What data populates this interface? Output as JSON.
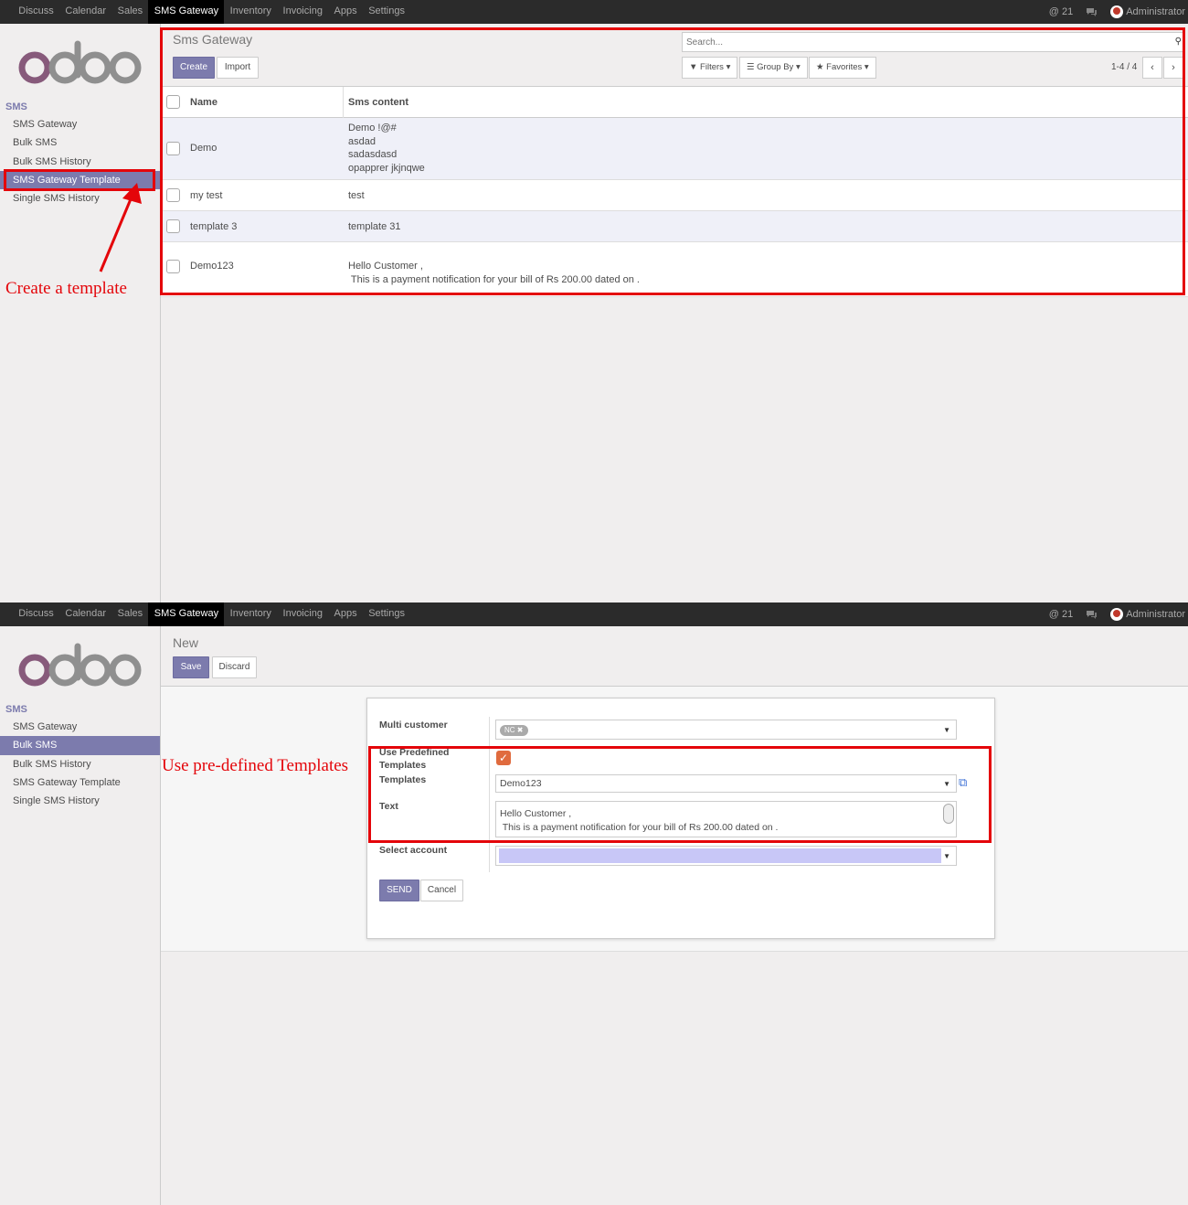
{
  "nav": {
    "menu": [
      "Discuss",
      "Calendar",
      "Sales",
      "SMS Gateway",
      "Inventory",
      "Invoicing",
      "Apps",
      "Settings"
    ],
    "active": "SMS Gateway",
    "notifications": "21",
    "user": "Administrator"
  },
  "sidebar": {
    "section": "SMS",
    "items": [
      "SMS Gateway",
      "Bulk SMS",
      "Bulk SMS History",
      "SMS Gateway Template",
      "Single SMS History"
    ],
    "items2": [
      "SMS Gateway",
      "Bulk SMS",
      "Bulk SMS History",
      "SMS Gateway Template",
      "Single SMS History"
    ]
  },
  "list_view": {
    "title": "Sms Gateway",
    "create_label": "Create",
    "import_label": "Import",
    "search_placeholder": "Search...",
    "filters_label": "Filters",
    "groupby_label": "Group By",
    "favorites_label": "Favorites",
    "pager": "1-4 / 4",
    "columns": [
      "Name",
      "Sms content"
    ],
    "rows": [
      {
        "name": "Demo",
        "content": [
          "Demo !@#",
          "asdad",
          "sadasdasd",
          "opapprer jkjnqwe"
        ]
      },
      {
        "name": "my test",
        "content": [
          "test"
        ]
      },
      {
        "name": "template 3",
        "content": [
          "template 31"
        ]
      },
      {
        "name": "Demo123",
        "content": [
          "Hello Customer ,",
          " This is a payment notification for your bill of Rs 200.00 dated on ."
        ]
      }
    ]
  },
  "form_view": {
    "title": "New",
    "save_label": "Save",
    "discard_label": "Discard",
    "multi_customer_label": "Multi customer",
    "customer_tag": "NC",
    "use_predefined_label": "Use Predefined Templates",
    "templates_label": "Templates",
    "template_value": "Demo123",
    "text_label": "Text",
    "text_value": [
      "Hello Customer ,",
      " This is a payment notification for your bill of Rs 200.00 dated on ."
    ],
    "select_account_label": "Select account",
    "send_label": "SEND",
    "cancel_label": "Cancel"
  },
  "annotations": {
    "create_template": "Create a template",
    "use_templates": "Use pre-defined Templates"
  },
  "colors": {
    "brand": "#7c7bad",
    "annotation": "#e4050a",
    "navbar": "#2b2b2b"
  }
}
